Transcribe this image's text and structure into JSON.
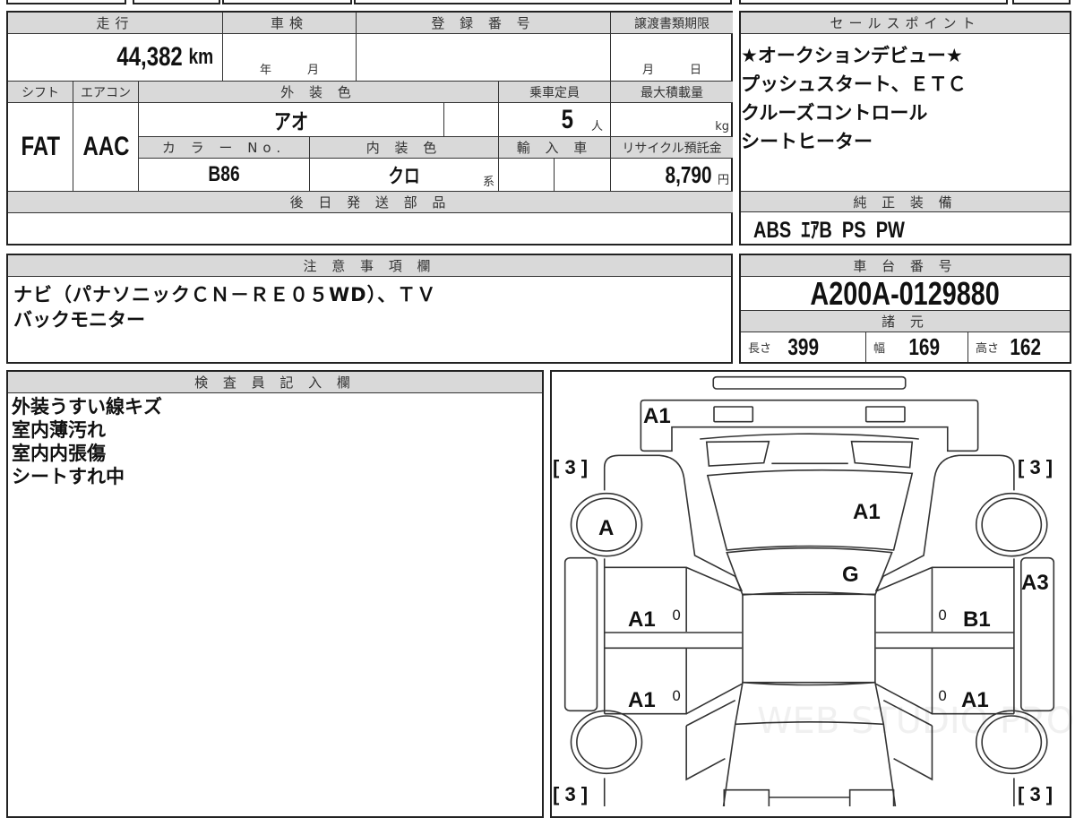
{
  "vehicle": {
    "mileage_label": "走行",
    "mileage": "44,382",
    "mileage_unit": "km",
    "inspection_label": "車検",
    "inspection_year_unit": "年",
    "inspection_month_unit": "月",
    "registration_label": "登 録 番 号",
    "transfer_deadline_label": "譲渡書類期限",
    "transfer_month_unit": "月",
    "transfer_day_unit": "日",
    "shift_label": "シフト",
    "shift": "FAT",
    "aircon_label": "エアコン",
    "aircon": "AAC",
    "exterior_color_label": "外 装 色",
    "exterior_color": "アオ",
    "capacity_label": "乗車定員",
    "capacity": "5",
    "capacity_unit": "人",
    "max_load_label": "最大積載量",
    "max_load_unit": "kg",
    "color_no_label": "カ ラ ー No.",
    "color_no": "B86",
    "interior_color_label": "内 装 色",
    "interior_color": "クロ",
    "interior_suffix": "系",
    "import_label": "輸 入 車",
    "recycle_label": "リサイクル預託金",
    "recycle_fee": "8,790",
    "recycle_unit": "円",
    "later_parts_label": "後 日 発 送 部 品"
  },
  "sales_points": {
    "label": "セールスポイント",
    "lines": [
      "★オークションデビュー★",
      "プッシュスタート、ＥＴＣ",
      "クルーズコントロール",
      "シートヒーター"
    ]
  },
  "equipment": {
    "label": "純 正 装 備",
    "value": "ABS  ｴｱB  PS  PW"
  },
  "notes": {
    "label": "注 意 事 項 欄",
    "lines": [
      "ナビ（パナソニックＣＮ－ＲＥ０５WD）、ＴＶ",
      "バックモニター"
    ]
  },
  "chassis": {
    "label": "車 台 番 号",
    "value": "A200A-0129880"
  },
  "specs": {
    "label": "諸 元",
    "length_label": "長さ",
    "length": "399",
    "width_label": "幅",
    "width": "169",
    "height_label": "高さ",
    "height": "162"
  },
  "inspector": {
    "label": "検 査 員 記 入 欄",
    "lines": [
      "外装うすい線キズ",
      "室内薄汚れ",
      "室内内張傷",
      "シートすれ中"
    ]
  },
  "diagram": {
    "marks": {
      "front_bumper": "A1",
      "hood": "A1",
      "front_left_wheel": "A",
      "windshield": "G",
      "right_side_panel": "A3",
      "left_front_door": "A1",
      "right_front_door": "B1",
      "left_rear_door": "A1",
      "right_rear_door": "A1",
      "tire_fl": "[ 3 ]",
      "tire_fr": "[ 3 ]",
      "tire_rl": "[ 3 ]",
      "tire_rr": "[ 3 ]",
      "door_zero": "0"
    },
    "watermark": "WEB STUDIO PRO"
  }
}
